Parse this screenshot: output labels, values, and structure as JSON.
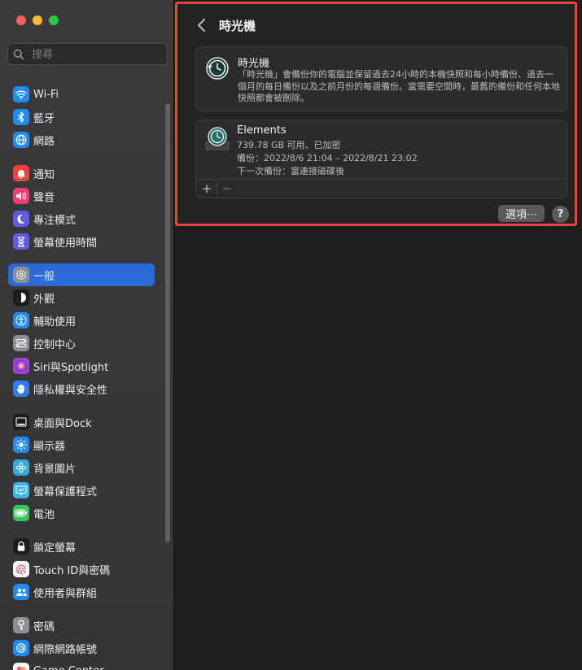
{
  "search": {
    "placeholder": "搜尋"
  },
  "sidebar": {
    "groups": [
      [
        {
          "label": "Wi-Fi",
          "icon": "wifi-icon",
          "color": "#1f8bf5"
        },
        {
          "label": "藍牙",
          "icon": "bluetooth-icon",
          "color": "#1f8bf5"
        },
        {
          "label": "網路",
          "icon": "globe-icon",
          "color": "#1f8bf5"
        }
      ],
      [
        {
          "label": "通知",
          "icon": "bell-icon",
          "color": "#f2413b"
        },
        {
          "label": "聲音",
          "icon": "speaker-icon",
          "color": "#f23d6e"
        },
        {
          "label": "專注模式",
          "icon": "moon-icon",
          "color": "#5e5ce6"
        },
        {
          "label": "螢幕使用時間",
          "icon": "hourglass-icon",
          "color": "#5e5ce6"
        }
      ],
      [
        {
          "label": "一般",
          "icon": "gear-icon",
          "color": "#8e8e93",
          "selected": true
        },
        {
          "label": "外觀",
          "icon": "appearance-icon",
          "color": "#1c1c1e"
        },
        {
          "label": "輔助使用",
          "icon": "accessibility-icon",
          "color": "#1f8bf5"
        },
        {
          "label": "控制中心",
          "icon": "control-center-icon",
          "color": "#8e8e93"
        },
        {
          "label": "Siri與Spotlight",
          "icon": "siri-icon",
          "color": "#b03bd6"
        },
        {
          "label": "隱私權與安全性",
          "icon": "hand-icon",
          "color": "#2f7cf6"
        }
      ],
      [
        {
          "label": "桌面與Dock",
          "icon": "dock-icon",
          "color": "#1c1c1e"
        },
        {
          "label": "顯示器",
          "icon": "sun-icon",
          "color": "#1f8bf5"
        },
        {
          "label": "背景圖片",
          "icon": "flower-icon",
          "color": "#34aadc"
        },
        {
          "label": "螢幕保護程式",
          "icon": "screensaver-icon",
          "color": "#3bb6e8"
        },
        {
          "label": "電池",
          "icon": "battery-icon",
          "color": "#34c759"
        }
      ],
      [
        {
          "label": "鎖定螢幕",
          "icon": "lock-icon",
          "color": "#1c1c1e"
        },
        {
          "label": "Touch ID與密碼",
          "icon": "fingerprint-icon",
          "color": "#f5f5f7"
        },
        {
          "label": "使用者與群組",
          "icon": "users-icon",
          "color": "#1f8bf5"
        }
      ],
      [
        {
          "label": "密碼",
          "icon": "key-icon",
          "color": "#8e8e93"
        },
        {
          "label": "網際網路帳號",
          "icon": "at-icon",
          "color": "#1f8bf5"
        },
        {
          "label": "Game Center",
          "icon": "game-center-icon",
          "color": "#f5f5f7"
        }
      ]
    ]
  },
  "main": {
    "title": "時光機",
    "info": {
      "title": "時光機",
      "description": "「時光機」會備份你的電腦並保留過去24小時的本機快照和每小時備份、過去一個月的每日備份以及之前月份的每週備份。當需要空間時，最舊的備份和任何本地快照都會被刪除。"
    },
    "disk": {
      "name": "Elements",
      "free": "739.78 GB 可用、已加密",
      "backup": "備份：2022/8/6 21:04 – 2022/8/21 23:02",
      "next": "下一次備份：當連接磁碟後"
    },
    "add_label": "+",
    "remove_label": "−",
    "options_label": "選項⋯",
    "help_label": "?"
  },
  "colors": {
    "accent": "#2b6bd6",
    "highlight": "#e04844"
  }
}
